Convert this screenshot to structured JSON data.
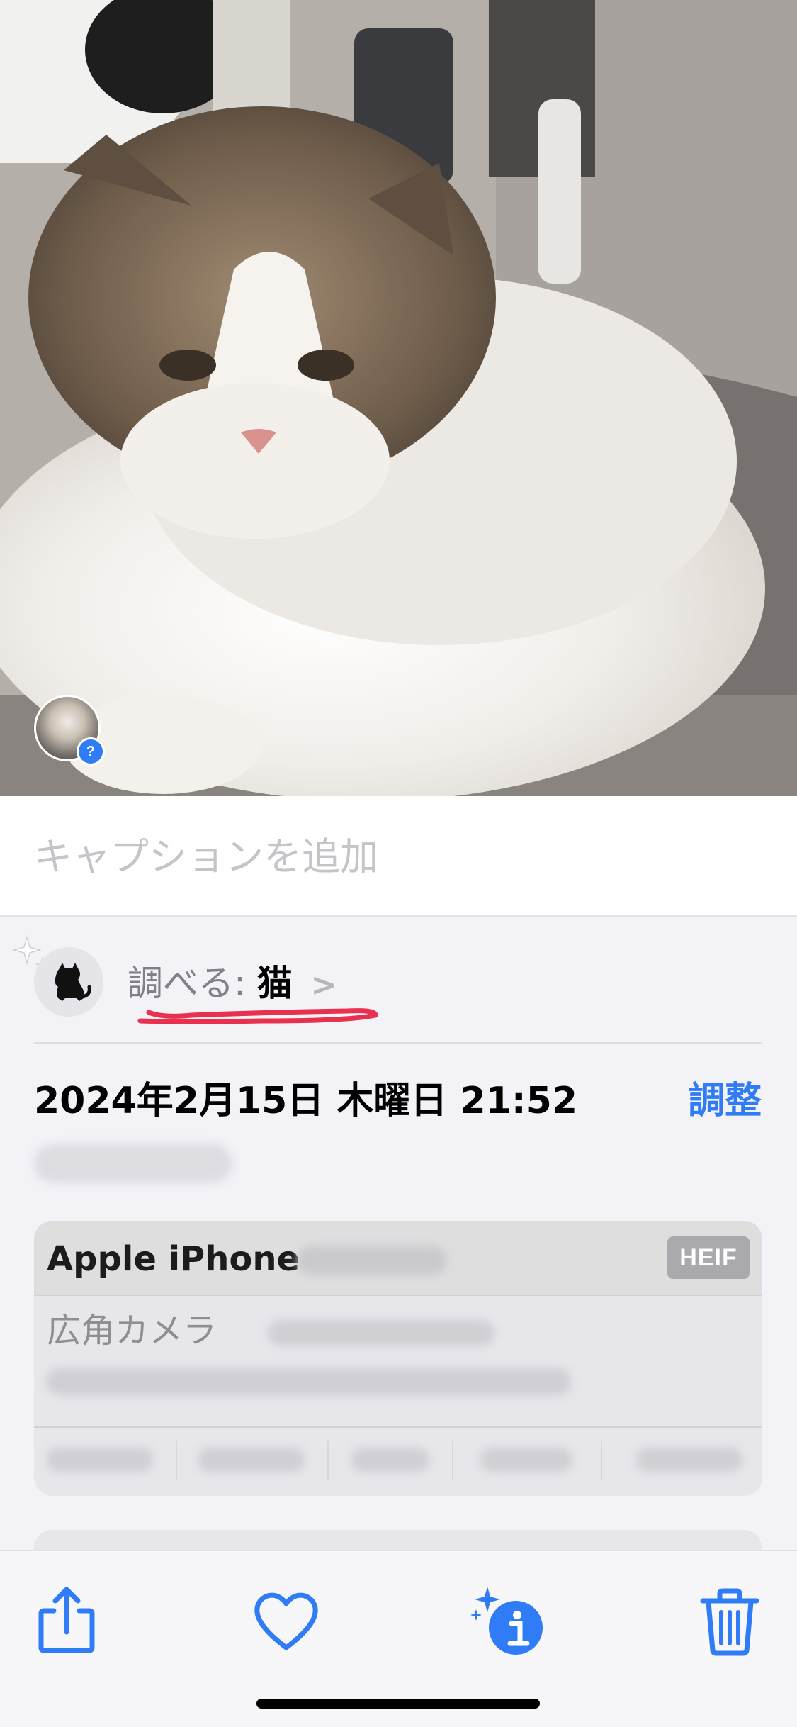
{
  "caption": {
    "placeholder": "キャプションを追加"
  },
  "lookup": {
    "prefix": "調べる:",
    "value": "猫",
    "chevron": ">",
    "icon": "cat-icon"
  },
  "date_row": {
    "datetime": "2024年2月15日 木曜日 21:52",
    "adjust_label": "調整"
  },
  "camera_info": {
    "device": "Apple iPhone",
    "format_badge": "HEIF",
    "lens": "広角カメラ"
  },
  "face_badge": "?",
  "toolbar": {
    "share_icon": "share-icon",
    "favorite_icon": "heart-icon",
    "info_icon": "info-sparkle-icon",
    "delete_icon": "trash-icon"
  },
  "colors": {
    "accent": "#2f7cf6",
    "annotation": "#e8304f",
    "secondary_text": "#808086"
  }
}
